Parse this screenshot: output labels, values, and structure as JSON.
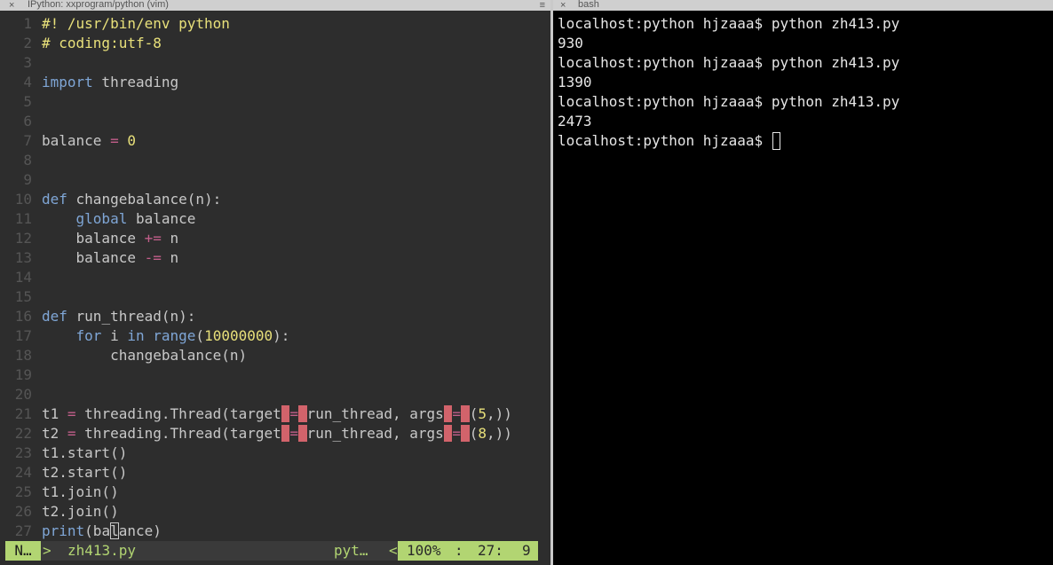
{
  "vim_pane": {
    "tab_title": "IPython: xxprogram/python (vim)",
    "tab_close": "×",
    "tab_menu": "≡",
    "lines": [
      {
        "n": "1",
        "tokens": [
          {
            "t": "#! /usr/bin/env python",
            "c": "comment"
          }
        ]
      },
      {
        "n": "2",
        "tokens": [
          {
            "t": "# coding:utf-8",
            "c": "comment"
          }
        ]
      },
      {
        "n": "3",
        "tokens": []
      },
      {
        "n": "4",
        "tokens": [
          {
            "t": "import",
            "c": "kw"
          },
          {
            "t": " threading",
            "c": "plain"
          }
        ]
      },
      {
        "n": "5",
        "tokens": []
      },
      {
        "n": "6",
        "tokens": []
      },
      {
        "n": "7",
        "tokens": [
          {
            "t": "balance ",
            "c": "plain"
          },
          {
            "t": "=",
            "c": "op"
          },
          {
            "t": " ",
            "c": "plain"
          },
          {
            "t": "0",
            "c": "num"
          }
        ]
      },
      {
        "n": "8",
        "tokens": []
      },
      {
        "n": "9",
        "tokens": []
      },
      {
        "n": "10",
        "tokens": [
          {
            "t": "def",
            "c": "kw"
          },
          {
            "t": " changebalance(n):",
            "c": "plain"
          }
        ]
      },
      {
        "n": "11",
        "tokens": [
          {
            "t": "    ",
            "c": "plain"
          },
          {
            "t": "global",
            "c": "kw"
          },
          {
            "t": " balance",
            "c": "plain"
          }
        ]
      },
      {
        "n": "12",
        "tokens": [
          {
            "t": "    balance ",
            "c": "plain"
          },
          {
            "t": "+=",
            "c": "op"
          },
          {
            "t": " n",
            "c": "plain"
          }
        ]
      },
      {
        "n": "13",
        "tokens": [
          {
            "t": "    balance ",
            "c": "plain"
          },
          {
            "t": "-=",
            "c": "op"
          },
          {
            "t": " n",
            "c": "plain"
          }
        ]
      },
      {
        "n": "14",
        "tokens": []
      },
      {
        "n": "15",
        "tokens": []
      },
      {
        "n": "16",
        "tokens": [
          {
            "t": "def",
            "c": "kw"
          },
          {
            "t": " run_thread(n):",
            "c": "plain"
          }
        ]
      },
      {
        "n": "17",
        "tokens": [
          {
            "t": "    ",
            "c": "plain"
          },
          {
            "t": "for",
            "c": "kw"
          },
          {
            "t": " i ",
            "c": "plain"
          },
          {
            "t": "in",
            "c": "kw"
          },
          {
            "t": " ",
            "c": "plain"
          },
          {
            "t": "range",
            "c": "kw"
          },
          {
            "t": "(",
            "c": "plain"
          },
          {
            "t": "10000000",
            "c": "num"
          },
          {
            "t": "):",
            "c": "plain"
          }
        ]
      },
      {
        "n": "18",
        "tokens": [
          {
            "t": "        changebalance(n)",
            "c": "plain"
          }
        ]
      },
      {
        "n": "19",
        "tokens": []
      },
      {
        "n": "20",
        "tokens": []
      },
      {
        "n": "21",
        "tokens": [
          {
            "t": "t1 ",
            "c": "plain"
          },
          {
            "t": "=",
            "c": "op"
          },
          {
            "t": " threading.Thread(target",
            "c": "plain"
          },
          {
            "t": " ",
            "c": "err"
          },
          {
            "t": "=",
            "c": "op"
          },
          {
            "t": " ",
            "c": "err"
          },
          {
            "t": "run_thread, args",
            "c": "plain"
          },
          {
            "t": " ",
            "c": "err"
          },
          {
            "t": "=",
            "c": "op"
          },
          {
            "t": " ",
            "c": "err"
          },
          {
            "t": "(",
            "c": "plain"
          },
          {
            "t": "5",
            "c": "num"
          },
          {
            "t": ",))",
            "c": "plain"
          }
        ]
      },
      {
        "n": "22",
        "tokens": [
          {
            "t": "t2 ",
            "c": "plain"
          },
          {
            "t": "=",
            "c": "op"
          },
          {
            "t": " threading.Thread(target",
            "c": "plain"
          },
          {
            "t": " ",
            "c": "err"
          },
          {
            "t": "=",
            "c": "op"
          },
          {
            "t": " ",
            "c": "err"
          },
          {
            "t": "run_thread, args",
            "c": "plain"
          },
          {
            "t": " ",
            "c": "err"
          },
          {
            "t": "=",
            "c": "op"
          },
          {
            "t": " ",
            "c": "err"
          },
          {
            "t": "(",
            "c": "plain"
          },
          {
            "t": "8",
            "c": "num"
          },
          {
            "t": ",))",
            "c": "plain"
          }
        ]
      },
      {
        "n": "23",
        "tokens": [
          {
            "t": "t1.start()",
            "c": "plain"
          }
        ]
      },
      {
        "n": "24",
        "tokens": [
          {
            "t": "t2.start()",
            "c": "plain"
          }
        ]
      },
      {
        "n": "25",
        "tokens": [
          {
            "t": "t1.join()",
            "c": "plain"
          }
        ]
      },
      {
        "n": "26",
        "tokens": [
          {
            "t": "t2.join()",
            "c": "plain"
          }
        ]
      },
      {
        "n": "27",
        "tokens": [
          {
            "t": "print",
            "c": "kw"
          },
          {
            "t": "(ba",
            "c": "plain"
          },
          {
            "t": "l",
            "c": "cursor"
          },
          {
            "t": "ance)",
            "c": "plain"
          }
        ]
      }
    ],
    "statusline": {
      "mode": "N…",
      "sep_left": ">",
      "filename": "zh413.py",
      "filetype": "pyt…",
      "sep_right": "<",
      "percent": "100%",
      "colon": ":",
      "row": "27:",
      "col": "9"
    }
  },
  "bash_pane": {
    "tab_title": "bash",
    "tab_close": "×",
    "lines": [
      "localhost:python hjzaaa$ python zh413.py",
      "930",
      "localhost:python hjzaaa$ python zh413.py",
      "1390",
      "localhost:python hjzaaa$ python zh413.py",
      "2473"
    ],
    "prompt": "localhost:python hjzaaa$ "
  },
  "colors": {
    "vim_bg": "#2d2d2d",
    "comment": "#e8e07a",
    "keyword": "#7fa6d6",
    "operator": "#c25e8a",
    "error_highlight": "#d2636b",
    "statusline_accent": "#b2d572",
    "terminal_bg": "#000000",
    "terminal_fg": "#e6e6e6"
  }
}
